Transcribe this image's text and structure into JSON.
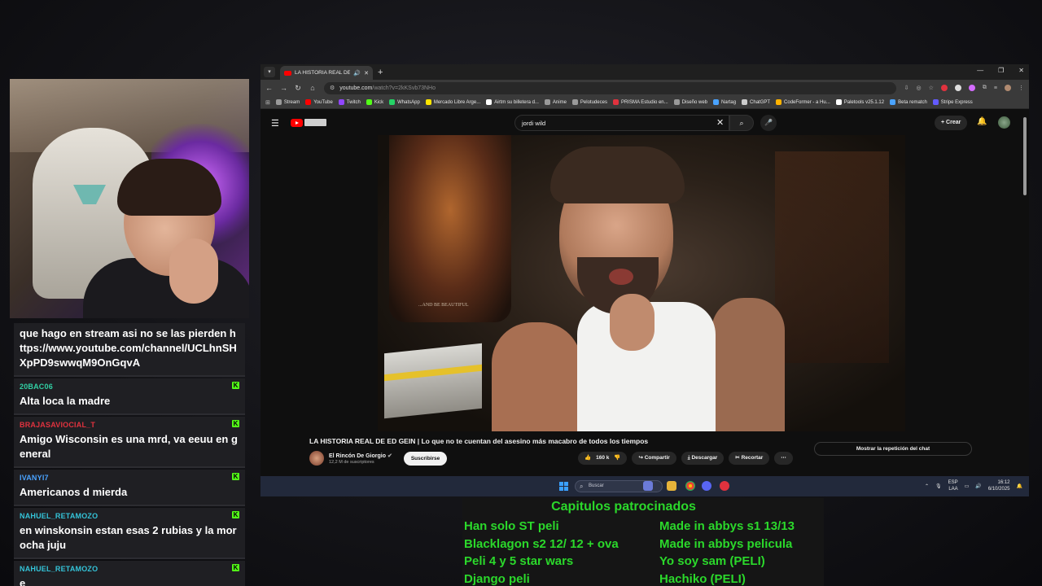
{
  "chat": {
    "messages": [
      {
        "user": "",
        "user_color": "#ffffff",
        "text": "que hago en stream asi no se las pierden https://www.youtube.com/channel/UCLhnSHXpPD9swwqM9OnGqvA",
        "badge": false
      },
      {
        "user": "20BAC06",
        "user_color": "#31d0a4",
        "text": "Alta loca la madre",
        "badge": true
      },
      {
        "user": "BRAJASAVIOCIAL_T",
        "user_color": "#e0323e",
        "text": "Amigo Wisconsin es una mrd, va eeuu en general",
        "badge": true
      },
      {
        "user": "IVANYI7",
        "user_color": "#4aa3ff",
        "text": "Americanos d mierda",
        "badge": true
      },
      {
        "user": "NAHUEL_RETAMOZO",
        "user_color": "#34c3d8",
        "text": "en winskonsin estan esas 2 rubias y la morocha juju",
        "badge": true
      },
      {
        "user": "NAHUEL_RETAMOZO",
        "user_color": "#34c3d8",
        "text": "e",
        "badge": true
      }
    ],
    "badge_icon": "K"
  },
  "browser": {
    "tab_title": "LA HISTORIA REAL DE ED G",
    "url_host": "youtube.com",
    "url_path": "/watch?v=2kKSvb73NHo",
    "bookmarks": [
      {
        "label": "Stream",
        "color": "#9a9a9a"
      },
      {
        "label": "YouTube",
        "color": "#ff0000"
      },
      {
        "label": "Twitch",
        "color": "#9146ff"
      },
      {
        "label": "Kick",
        "color": "#53fc18"
      },
      {
        "label": "WhatsApp",
        "color": "#25d366"
      },
      {
        "label": "Mercado Libre Arge...",
        "color": "#ffe600"
      },
      {
        "label": "Airtm su billetera d...",
        "color": "#ffffff"
      },
      {
        "label": "Anime",
        "color": "#9a9a9a"
      },
      {
        "label": "Pelotudeces",
        "color": "#9a9a9a"
      },
      {
        "label": "PRISMA Estudio en...",
        "color": "#e0323e"
      },
      {
        "label": "Diseño web",
        "color": "#9a9a9a"
      },
      {
        "label": "Nartag",
        "color": "#4aa3ff"
      },
      {
        "label": "ChatGPT",
        "color": "#cccccc"
      },
      {
        "label": "CodeFormer - a Hu...",
        "color": "#ffb300"
      },
      {
        "label": "Paletools v25.1.12",
        "color": "#ffffff"
      },
      {
        "label": "Beta rematch",
        "color": "#4aa3ff"
      },
      {
        "label": "Stripe Express",
        "color": "#635bff"
      }
    ]
  },
  "youtube": {
    "search_query": "jordi wild",
    "create_label": "Crear",
    "video_title": "LA HISTORIA REAL DE ED GEIN | Lo que no te cuentan del asesino más macabro de todos los tiempos",
    "poster_text": "...AND BE BEAUTIFUL",
    "channel_name": "El Rincón De Giorgio",
    "subscribers": "12,2 M de suscriptores",
    "subscribe_label": "Suscribirse",
    "likes": "160 k",
    "share_label": "Compartir",
    "download_label": "Descargar",
    "clip_label": "Recortar",
    "chat_replay_label": "Mostrar la repetición del chat"
  },
  "taskbar": {
    "search_placeholder": "Buscar",
    "lang_line1": "ESP",
    "lang_line2": "LAA",
    "time": "16:12",
    "date": "6/10/2025"
  },
  "sponsors": {
    "title": "Capitulos patrocinados",
    "left": [
      "Han solo ST peli",
      "Blacklagon s2 12/ 12 + ova",
      "Peli 4  y 5 star wars",
      "Django peli"
    ],
    "right": [
      "Made in abbys s1 13/13",
      "Made in abbys pelicula",
      "Yo soy sam (PELI)",
      "Hachiko (PELI)"
    ]
  }
}
